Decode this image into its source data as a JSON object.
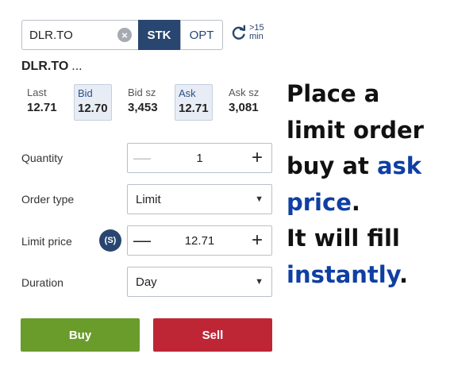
{
  "ticket": {
    "symbol_value": "DLR.TO",
    "segments": {
      "stk": "STK",
      "opt": "OPT"
    },
    "delay": {
      "top": ">15",
      "bottom": "min"
    },
    "symbol_title": "DLR.TO",
    "symbol_dots": "...",
    "quote": [
      {
        "label": "Last",
        "value": "12.71"
      },
      {
        "label": "Bid",
        "value": "12.70"
      },
      {
        "label": "Bid sz",
        "value": "3,453"
      },
      {
        "label": "Ask",
        "value": "12.71"
      },
      {
        "label": "Ask sz",
        "value": "3,081"
      }
    ],
    "quantity": {
      "label": "Quantity",
      "value": "1",
      "minus": "—",
      "plus": "+"
    },
    "order_type": {
      "label": "Order type",
      "value": "Limit"
    },
    "limit_price": {
      "label": "Limit price",
      "value": "12.71",
      "minus": "—",
      "plus": "+",
      "icon_text": "(S)"
    },
    "duration": {
      "label": "Duration",
      "value": "Day"
    },
    "buttons": {
      "buy": "Buy",
      "sell": "Sell"
    }
  },
  "callout": {
    "line1": "Place a",
    "line2": "limit order",
    "line3a": "buy at ",
    "line3b": "ask",
    "line4a": "price",
    "line4b": ".",
    "line5": "It will fill",
    "line6a": "instantly",
    "line6b": "."
  },
  "colors": {
    "brand_navy": "#28466f",
    "buy_green": "#6a9c2c",
    "sell_red": "#be2636",
    "callout_accent": "#0f3fa3"
  }
}
